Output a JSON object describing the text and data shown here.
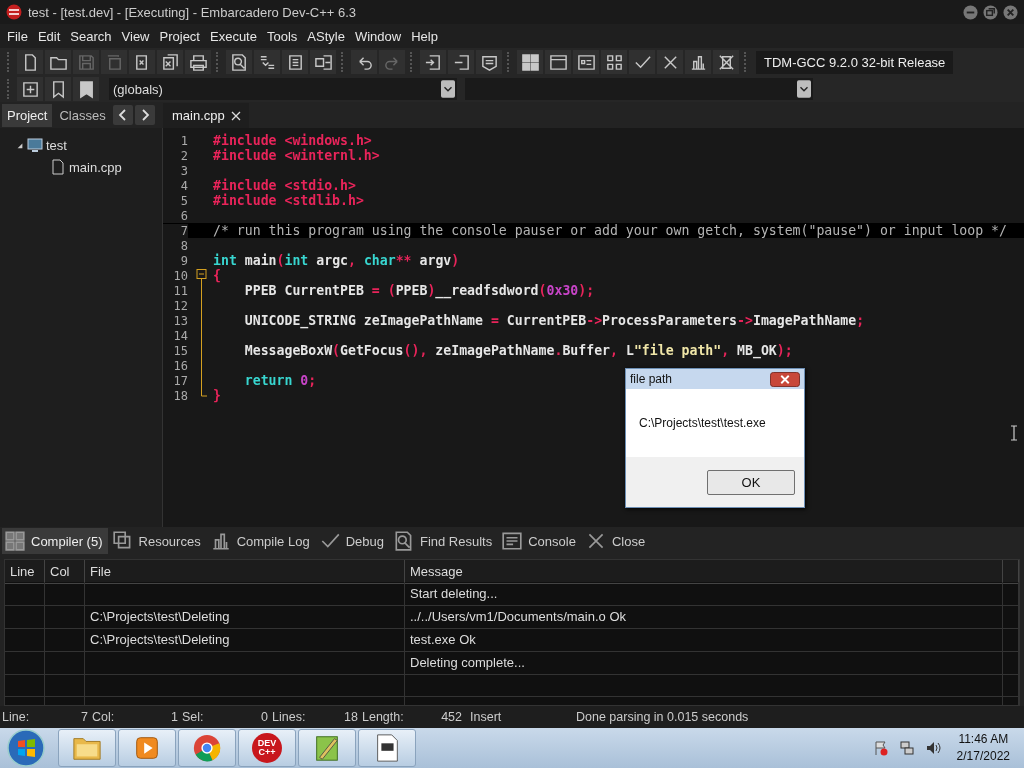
{
  "window": {
    "title": "test - [test.dev] - [Executing] - Embarcadero Dev-C++ 6.3"
  },
  "menu": [
    "File",
    "Edit",
    "Search",
    "View",
    "Project",
    "Execute",
    "Tools",
    "AStyle",
    "Window",
    "Help"
  ],
  "toolbar": [
    {
      "kind": "new",
      "disabled": false
    },
    {
      "kind": "open",
      "disabled": false
    },
    {
      "kind": "save",
      "disabled": true
    },
    {
      "kind": "saveall",
      "disabled": true
    },
    {
      "kind": "close",
      "disabled": false
    },
    {
      "kind": "closeall",
      "disabled": false
    },
    {
      "kind": "print",
      "disabled": false
    },
    {
      "kind": "find",
      "disabled": false
    },
    {
      "kind": "replace",
      "disabled": false
    },
    {
      "kind": "indent",
      "disabled": false
    },
    {
      "kind": "goto",
      "disabled": false
    },
    {
      "kind": "undo",
      "disabled": false
    },
    {
      "kind": "redo",
      "disabled": true
    },
    {
      "kind": "addfile",
      "disabled": false
    },
    {
      "kind": "removefile",
      "disabled": false
    },
    {
      "kind": "options",
      "disabled": false
    },
    {
      "kind": "compile",
      "disabled": false
    },
    {
      "kind": "run",
      "disabled": false
    },
    {
      "kind": "compilerun",
      "disabled": false
    },
    {
      "kind": "rebuild",
      "disabled": false
    },
    {
      "kind": "check",
      "disabled": false
    },
    {
      "kind": "cross",
      "disabled": false
    },
    {
      "kind": "chart",
      "disabled": false
    },
    {
      "kind": "stop",
      "disabled": false
    }
  ],
  "compiler_select": {
    "value": "TDM-GCC 9.2.0 32-bit Release"
  },
  "scope_select": {
    "value": "(globals)"
  },
  "side_tabs": [
    {
      "label": "Project",
      "selected": true
    },
    {
      "label": "Classes",
      "selected": false
    }
  ],
  "editor_tabs": [
    {
      "label": "main.cpp",
      "selected": true
    }
  ],
  "project_tree": [
    {
      "label": "test",
      "expanded": true,
      "children": [
        {
          "label": "main.cpp"
        }
      ]
    }
  ],
  "editor": {
    "lines": [
      {
        "number": "1",
        "current": false,
        "kind": "plain",
        "tokens": [
          {
            "kind": "pp",
            "t": "#include <windows.h>"
          }
        ]
      },
      {
        "number": "2",
        "current": false,
        "kind": "plain",
        "tokens": [
          {
            "kind": "pp",
            "t": "#include <winternl.h>"
          }
        ]
      },
      {
        "number": "3",
        "current": false,
        "kind": "plain"
      },
      {
        "number": "4",
        "current": false,
        "kind": "plain",
        "tokens": [
          {
            "kind": "pp",
            "t": "#include <stdio.h>"
          }
        ]
      },
      {
        "number": "5",
        "current": false,
        "kind": "plain",
        "tokens": [
          {
            "kind": "pp",
            "t": "#include <stdlib.h>"
          }
        ]
      },
      {
        "number": "6",
        "current": false,
        "kind": "plain"
      },
      {
        "number": "7",
        "current": true,
        "kind": "plain",
        "tokens": [
          {
            "kind": "comment",
            "t": "/* run this program using the console pauser or add your own getch, system(\"pause\") or input loop */"
          }
        ]
      },
      {
        "number": "8",
        "current": false,
        "kind": "plain"
      },
      {
        "number": "9",
        "current": false,
        "kind": "plain",
        "tokens": [
          {
            "kind": "kw",
            "t": "int"
          },
          {
            "kind": "id",
            "t": " main"
          },
          {
            "kind": "sym",
            "t": "("
          },
          {
            "kind": "kw",
            "t": "int"
          },
          {
            "kind": "id",
            "t": " argc"
          },
          {
            "kind": "sym",
            "t": ", "
          },
          {
            "kind": "kw",
            "t": "char"
          },
          {
            "kind": "sym",
            "t": "**"
          },
          {
            "kind": "id",
            "t": " argv"
          },
          {
            "kind": "sym",
            "t": ")"
          }
        ]
      },
      {
        "number": "10",
        "current": false,
        "kind": "fold_start",
        "tokens": [
          {
            "kind": "sym",
            "t": "{"
          }
        ]
      },
      {
        "number": "11",
        "current": false,
        "kind": "fold_body",
        "tokens": [
          {
            "kind": "id",
            "t": "    PPEB CurrentPEB "
          },
          {
            "kind": "sym",
            "t": "= ("
          },
          {
            "kind": "id",
            "t": "PPEB"
          },
          {
            "kind": "sym",
            "t": ")"
          },
          {
            "kind": "id",
            "t": "__readfsdword"
          },
          {
            "kind": "sym",
            "t": "("
          },
          {
            "kind": "num",
            "t": "0x30"
          },
          {
            "kind": "sym",
            "t": ");"
          }
        ]
      },
      {
        "number": "12",
        "current": false,
        "kind": "fold_body"
      },
      {
        "number": "13",
        "current": false,
        "kind": "fold_body",
        "tokens": [
          {
            "kind": "id",
            "t": "    UNICODE_STRING zeImagePathName "
          },
          {
            "kind": "sym",
            "t": "="
          },
          {
            "kind": "id",
            "t": " CurrentPEB"
          },
          {
            "kind": "sym",
            "t": "->"
          },
          {
            "kind": "id",
            "t": "ProcessParameters"
          },
          {
            "kind": "sym",
            "t": "->"
          },
          {
            "kind": "id",
            "t": "ImagePathName"
          },
          {
            "kind": "sym",
            "t": ";"
          }
        ]
      },
      {
        "number": "14",
        "current": false,
        "kind": "fold_body"
      },
      {
        "number": "15",
        "current": false,
        "kind": "fold_body",
        "tokens": [
          {
            "kind": "id",
            "t": "    MessageBoxW"
          },
          {
            "kind": "sym",
            "t": "("
          },
          {
            "kind": "id",
            "t": "GetFocus"
          },
          {
            "kind": "sym",
            "t": "(), "
          },
          {
            "kind": "id",
            "t": "zeImagePathName"
          },
          {
            "kind": "sym",
            "t": "."
          },
          {
            "kind": "id",
            "t": "Buffer"
          },
          {
            "kind": "sym",
            "t": ", "
          },
          {
            "kind": "id",
            "t": "L"
          },
          {
            "kind": "str",
            "t": "\"file path\""
          },
          {
            "kind": "sym",
            "t": ", "
          },
          {
            "kind": "id",
            "t": "MB_OK"
          },
          {
            "kind": "sym",
            "t": ");"
          }
        ]
      },
      {
        "number": "16",
        "current": false,
        "kind": "fold_body"
      },
      {
        "number": "17",
        "current": false,
        "kind": "fold_body",
        "tokens": [
          {
            "kind": "kw",
            "t": "    return"
          },
          {
            "kind": "num",
            "t": " 0"
          },
          {
            "kind": "sym",
            "t": ";"
          }
        ]
      },
      {
        "number": "18",
        "current": false,
        "kind": "fold_end",
        "tokens": [
          {
            "kind": "sym",
            "t": "}"
          }
        ]
      }
    ]
  },
  "dialog": {
    "title": "file path",
    "message": "C:\\Projects\\test\\test.exe",
    "button": "OK"
  },
  "bottom_tabs": [
    {
      "label": "Compiler (5)",
      "kind": "grid",
      "selected": true
    },
    {
      "label": "Resources",
      "kind": "copy",
      "selected": false
    },
    {
      "label": "Compile Log",
      "kind": "chart",
      "selected": false
    },
    {
      "label": "Debug",
      "kind": "check",
      "selected": false
    },
    {
      "label": "Find Results",
      "kind": "find",
      "selected": false
    },
    {
      "label": "Console",
      "kind": "console",
      "selected": false
    },
    {
      "label": "Close",
      "kind": "cross",
      "selected": false
    }
  ],
  "messages": {
    "columns": [
      "Line",
      "Col",
      "File",
      "Message"
    ],
    "rows": [
      {
        "message": "Start deleting..."
      },
      {
        "file": "C:\\Projects\\test\\Deleting",
        "message": "../../Users/vm1/Documents/main.o Ok"
      },
      {
        "file": "C:\\Projects\\test\\Deleting",
        "message": "test.exe Ok"
      },
      {
        "message": "Deleting complete..."
      }
    ]
  },
  "status_bar": {
    "fields": [
      {
        "label": "Line:",
        "value": "7"
      },
      {
        "label": "Col:",
        "value": "1"
      },
      {
        "label": "Sel:",
        "value": "0"
      },
      {
        "label": "Lines:",
        "value": "18"
      },
      {
        "label": "Length:",
        "value": "452"
      }
    ],
    "mode": "Insert",
    "message": "Done parsing in 0.015 seconds"
  },
  "taskbar": {
    "apps": [
      {
        "kind": "explorer"
      },
      {
        "kind": "media"
      },
      {
        "kind": "chrome"
      },
      {
        "kind": "devcpp",
        "logo_lines": [
          "DEV",
          "C++"
        ]
      },
      {
        "kind": "editor"
      },
      {
        "kind": "document"
      }
    ],
    "time": "11:46 AM",
    "date": "2/17/2022"
  }
}
